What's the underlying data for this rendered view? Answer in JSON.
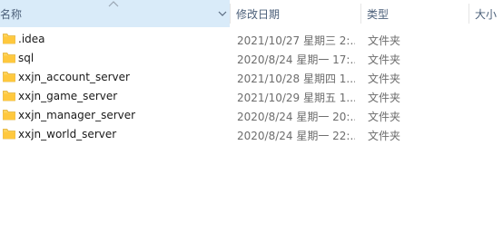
{
  "columns": {
    "name": "名称",
    "modified": "修改日期",
    "type": "类型",
    "size": "大小"
  },
  "sort": {
    "column": "name",
    "direction": "ascending",
    "icon": "sort-up-icon"
  },
  "colors": {
    "header_selected_bg": "#d9ebf9",
    "header_text": "#4c607a",
    "folder_yellow": "#ffd35c"
  },
  "files": [
    {
      "name": ".idea",
      "modified": "2021/10/27 星期三 2:...",
      "type": "文件夹",
      "icon": "folder-icon"
    },
    {
      "name": "sql",
      "modified": "2020/8/24 星期一 17:...",
      "type": "文件夹",
      "icon": "folder-icon"
    },
    {
      "name": "xxjn_account_server",
      "modified": "2021/10/28 星期四 1...",
      "type": "文件夹",
      "icon": "folder-icon"
    },
    {
      "name": "xxjn_game_server",
      "modified": "2021/10/29 星期五 1...",
      "type": "文件夹",
      "icon": "folder-icon"
    },
    {
      "name": "xxjn_manager_server",
      "modified": "2020/8/24 星期一 20:...",
      "type": "文件夹",
      "icon": "folder-icon"
    },
    {
      "name": "xxjn_world_server",
      "modified": "2020/8/24 星期一 22:...",
      "type": "文件夹",
      "icon": "folder-icon"
    }
  ]
}
